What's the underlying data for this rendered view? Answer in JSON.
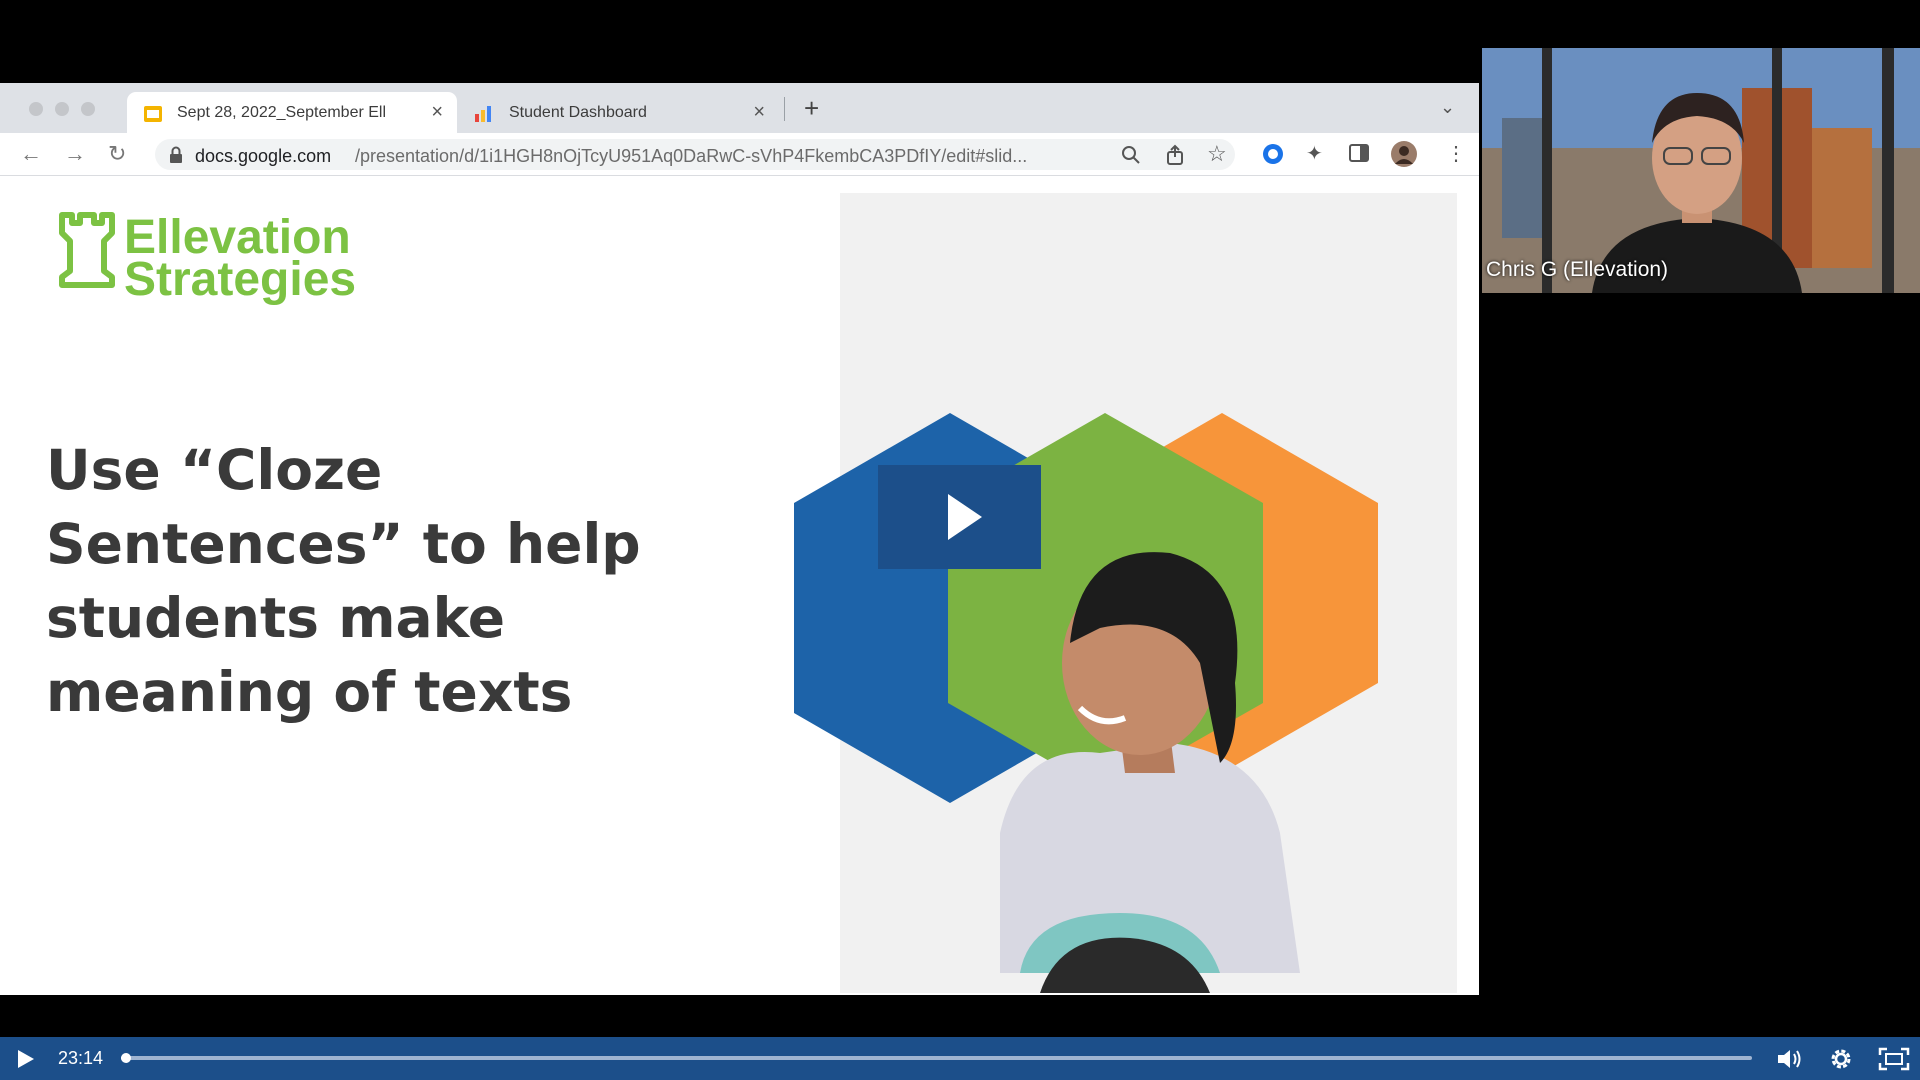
{
  "browser": {
    "tabs": [
      {
        "label": "Sept 28, 2022_September Ell",
        "favicon": "google-slides-icon",
        "active": true
      },
      {
        "label": "Student Dashboard",
        "favicon": "bar-chart-icon",
        "active": false
      }
    ],
    "url_domain": "docs.google.com",
    "url_path": "/presentation/d/1i1HGH8nOjTcyU951Aq0DaRwC-sVhP4FkembCA3PDfIY/edit#slid..."
  },
  "slide": {
    "brand_line1": "Ellevation",
    "brand_line2": "Strategies",
    "headline": "Use “Cloze Sentences” to help students make meaning of texts",
    "hex_colors": {
      "blue": "#1d63a9",
      "green": "#7cb342",
      "orange": "#f7953a"
    }
  },
  "presenter": {
    "name": "Chris G (Ellevation)"
  },
  "player": {
    "time": "23:14",
    "progress": 0.003,
    "accent": "#1c4f8a",
    "icons": [
      "play-icon",
      "volume-icon",
      "settings-icon",
      "fullscreen-icon"
    ]
  }
}
